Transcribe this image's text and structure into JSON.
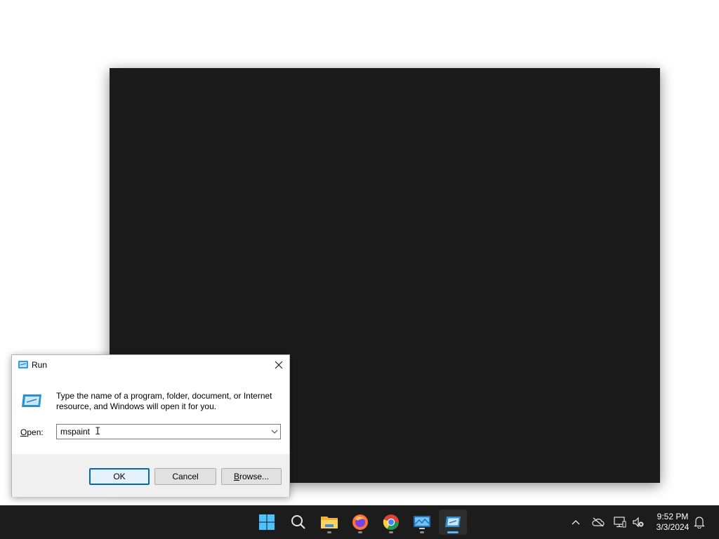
{
  "run_dialog": {
    "title": "Run",
    "description": "Type the name of a program, folder, document, or Internet resource, and Windows will open it for you.",
    "open_label_prefix": "O",
    "open_label_rest": "pen:",
    "input_value": "mspaint",
    "ok_label": "OK",
    "cancel_label": "Cancel",
    "browse_label_prefix": "B",
    "browse_label_rest": "rowse..."
  },
  "taskbar": {
    "apps": [
      {
        "icon": "windows-start-icon"
      },
      {
        "icon": "search-icon"
      },
      {
        "icon": "file-explorer-icon"
      },
      {
        "icon": "firefox-icon"
      },
      {
        "icon": "chrome-icon"
      },
      {
        "icon": "remote-desktop-icon"
      },
      {
        "icon": "run-app-icon",
        "active": true
      }
    ],
    "tray": [
      "chevron-up-icon",
      "cloud-off-icon",
      "network-icon",
      "volume-muted-icon",
      "notification-bell-icon"
    ],
    "time": "9:52 PM",
    "date": "3/3/2024"
  },
  "colors": {
    "taskbar_bg": "#1c1c1c",
    "window_bg": "#1b1b1b",
    "accent": "#0067c0"
  }
}
